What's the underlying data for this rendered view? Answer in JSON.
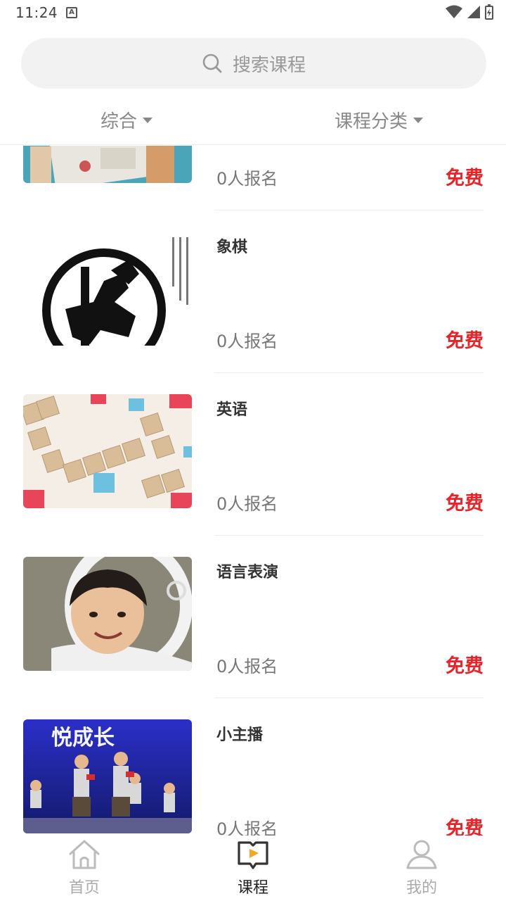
{
  "status": {
    "time": "11:24",
    "a_badge": "A"
  },
  "search": {
    "placeholder": "搜索课程"
  },
  "filters": {
    "sort_label": "综合",
    "category_label": "课程分类"
  },
  "courses": [
    {
      "title": "",
      "enroll": "0人报名",
      "price": "免费",
      "thumb": "stamp-cards"
    },
    {
      "title": "象棋",
      "enroll": "0人报名",
      "price": "免费",
      "thumb": "chess-seal"
    },
    {
      "title": "英语",
      "enroll": "0人报名",
      "price": "免费",
      "thumb": "scrabble-tiles"
    },
    {
      "title": "语言表演",
      "enroll": "0人报名",
      "price": "免费",
      "thumb": "child-astronaut"
    },
    {
      "title": "小主播",
      "enroll": "0人报名",
      "price": "免费",
      "thumb": "stage-kids"
    }
  ],
  "thumb_text": {
    "stage_banner": "悦成长"
  },
  "nav": {
    "home": "首页",
    "course": "课程",
    "mine": "我的"
  },
  "colors": {
    "price": "#e8242b",
    "accent": "#f5a623",
    "nav_active": "#222222"
  }
}
